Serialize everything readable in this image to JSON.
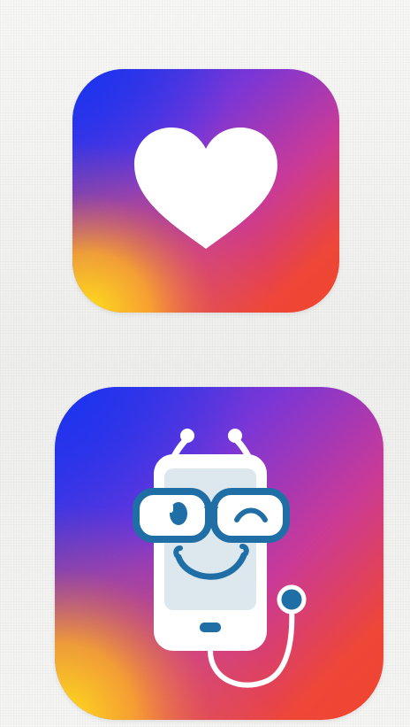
{
  "screen": {
    "background_color": "#f3f3f1"
  },
  "apps": [
    {
      "icon": "heart-icon",
      "gradient": [
        "#2f3fe0",
        "#8b3ad0",
        "#d93a8a",
        "#f4502f",
        "#ffd21a"
      ],
      "glyph_color": "#ffffff"
    },
    {
      "icon": "doctor-phone-icon",
      "gradient": [
        "#2f3fe0",
        "#8b3ad0",
        "#d93a8a",
        "#f4502f",
        "#ffd21a"
      ],
      "glyph_color": "#ffffff",
      "accent_color": "#1f6fa6"
    }
  ]
}
